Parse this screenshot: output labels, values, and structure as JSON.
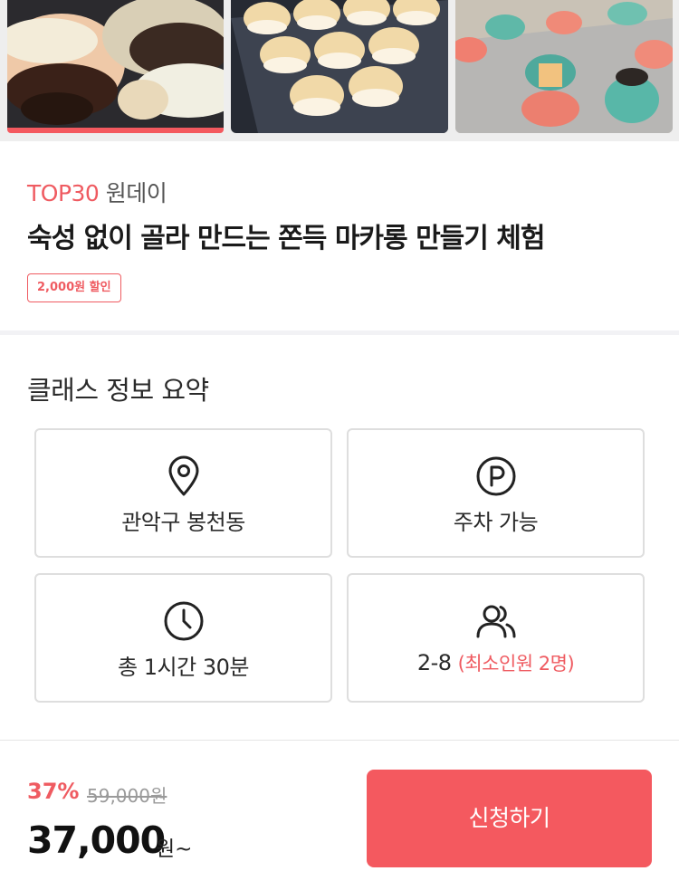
{
  "gallery": {
    "photos": [
      {
        "alt": "chocolate-filled macarons photo"
      },
      {
        "alt": "macarons on baking tray photo"
      },
      {
        "alt": "decorated colorful macarons photo"
      }
    ]
  },
  "header": {
    "category_rank": "TOP30",
    "category_name": " 원데이",
    "title": "숙성 없이 골라 만드는 쫀득 마카롱 만들기 체험",
    "discount_badge": "2,000원 할인"
  },
  "summary": {
    "title": "클래스 정보 요약",
    "location": {
      "icon": "location-pin-icon",
      "label": "관악구 봉천동"
    },
    "parking": {
      "icon": "parking-icon",
      "label": "주차 가능"
    },
    "duration": {
      "icon": "clock-icon",
      "label": "총 1시간 30분"
    },
    "capacity": {
      "icon": "users-icon",
      "label": "2-8",
      "note": "(최소인원 2명)"
    }
  },
  "pricing": {
    "discount_rate": "37%",
    "original_price": "59,000원",
    "final_price": "37,000",
    "unit": "원~",
    "apply_label": "신청하기"
  },
  "colors": {
    "accent": "#f4595f",
    "border": "#dedede",
    "text": "#1f1f1f"
  }
}
